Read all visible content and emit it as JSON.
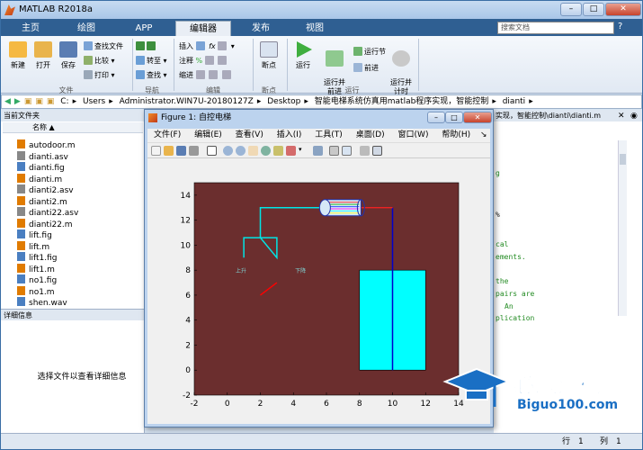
{
  "app": {
    "title": "MATLAB R2018a",
    "search_placeholder": "搜索文档"
  },
  "tabs": [
    "主页",
    "绘图",
    "APP",
    "编辑器",
    "发布",
    "视图"
  ],
  "ribbon": {
    "file": {
      "new": "新建",
      "open": "打开",
      "save": "保存",
      "find_files": "查找文件",
      "compare": "比较",
      "print": "打印",
      "label": "文件"
    },
    "nav": {
      "goto": "转至",
      "find": "查找",
      "label": "导航"
    },
    "edit": {
      "insert": "插入",
      "comment": "注释",
      "indent": "缩进",
      "label": "编辑"
    },
    "breakpoints": {
      "bp": "断点",
      "label": "断点"
    },
    "run": {
      "run": "运行",
      "run_advance": "运行并\n前进",
      "run_section": "运行节",
      "advance": "前进",
      "run_time": "运行并\n计时",
      "label": "运行"
    }
  },
  "address": [
    "C:",
    "Users",
    "Administrator.WIN7U-20180127Z",
    "Desktop",
    "智能电梯系统仿真用matlab程序实现，智能控制",
    "dianti"
  ],
  "current_folder": {
    "header": "当前文件夹",
    "col_name": "名称 ▲",
    "files": [
      {
        "name": "autodoor.m",
        "color": "#e07b00"
      },
      {
        "name": "dianti.asv",
        "color": "#888888"
      },
      {
        "name": "dianti.fig",
        "color": "#4a7fc1"
      },
      {
        "name": "dianti.m",
        "color": "#e07b00"
      },
      {
        "name": "dianti2.asv",
        "color": "#888888"
      },
      {
        "name": "dianti2.m",
        "color": "#e07b00"
      },
      {
        "name": "dianti22.asv",
        "color": "#888888"
      },
      {
        "name": "dianti22.m",
        "color": "#e07b00"
      },
      {
        "name": "lift.fig",
        "color": "#4a7fc1"
      },
      {
        "name": "lift.m",
        "color": "#e07b00"
      },
      {
        "name": "lift1.fig",
        "color": "#4a7fc1"
      },
      {
        "name": "lift1.m",
        "color": "#e07b00"
      },
      {
        "name": "no1.fig",
        "color": "#4a7fc1"
      },
      {
        "name": "no1.m",
        "color": "#e07b00"
      },
      {
        "name": "shen.wav",
        "color": "#4a7fc1"
      }
    ]
  },
  "details": {
    "header": "详细信息",
    "message": "选择文件以查看详细信息"
  },
  "editor": {
    "header": "实现，智能控制\\dianti\\dianti.m",
    "lines": [
      "cal",
      "ements.",
      "the",
      "pairs are",
      "An",
      "plication"
    ]
  },
  "status": {
    "row_label": "行",
    "row": "1",
    "col_label": "列",
    "col": "1"
  },
  "figure": {
    "title": "Figure 1: 自控电梯",
    "menu": [
      "文件(F)",
      "编辑(E)",
      "查看(V)",
      "插入(I)",
      "工具(T)",
      "桌面(D)",
      "窗口(W)",
      "帮助(H)"
    ]
  },
  "chart_data": {
    "type": "scatter",
    "title": "",
    "xlabel": "",
    "ylabel": "",
    "xlim": [
      -2,
      14
    ],
    "ylim": [
      -2,
      15
    ],
    "xticks": [
      -2,
      0,
      2,
      4,
      6,
      8,
      10,
      12,
      14
    ],
    "yticks": [
      -2,
      0,
      2,
      4,
      6,
      8,
      10,
      12,
      14
    ],
    "background": "#6b2e2e",
    "annotations": [
      "上升",
      "下降"
    ],
    "elements": {
      "car_box": {
        "x": [
          8,
          12
        ],
        "y": [
          0,
          8
        ],
        "color": "#00ffff"
      },
      "car_rope": {
        "x": [
          10,
          10
        ],
        "y": [
          0,
          13
        ],
        "color": "#0000cc"
      },
      "cyan_lines": {
        "x": [
          1,
          1,
          3,
          3,
          2,
          2,
          6
        ],
        "y": [
          9,
          10.6,
          10.6,
          9,
          10.6,
          13,
          13
        ],
        "color": "#00e5e5"
      },
      "red_needle": {
        "x": [
          2,
          3
        ],
        "y": [
          6,
          7
        ],
        "color": "#ff0000"
      },
      "motor_center": {
        "x": 7,
        "y": 13
      }
    }
  },
  "watermark": {
    "cn": "必过源码",
    "en": "Biguo100.com"
  }
}
